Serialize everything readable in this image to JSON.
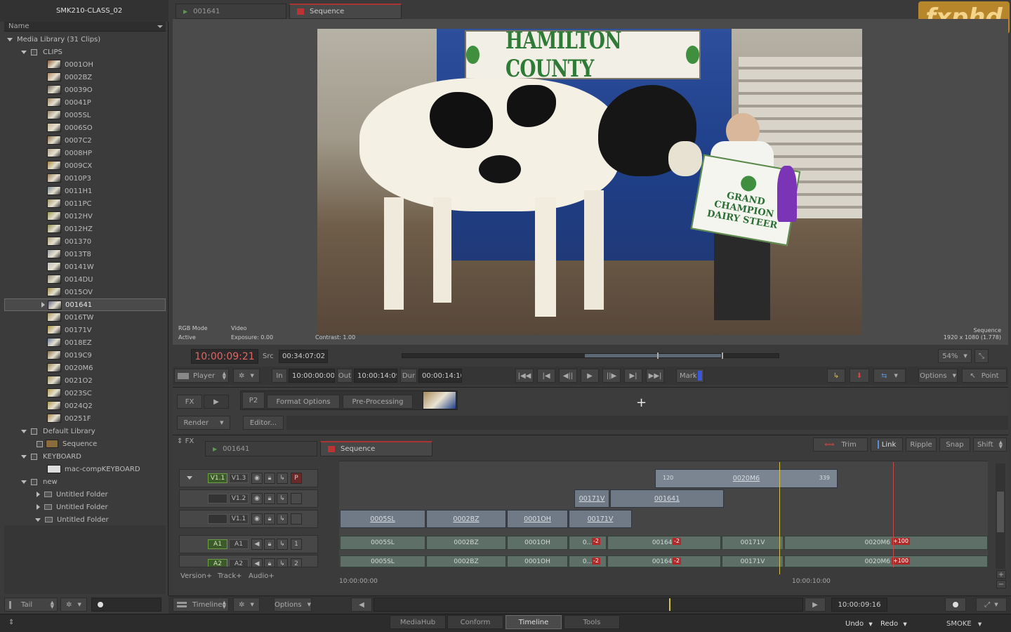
{
  "app": {
    "project_title": "SMK210-CLASS_02",
    "logo": "fxphd",
    "module_name": "SMOKE"
  },
  "library": {
    "column_header": "Name",
    "media_library_label": "Media Library (31 Clips)",
    "clips_folder": "CLIPS",
    "clips": [
      "0001OH",
      "0002BZ",
      "00039O",
      "00041P",
      "0005SL",
      "0006SO",
      "0007C2",
      "0008HP",
      "0009CX",
      "0010P3",
      "0011H1",
      "0011PC",
      "0012HV",
      "0012HZ",
      "001370",
      "0013T8",
      "00141W",
      "0014DU",
      "0015OV",
      "001641",
      "0016TW",
      "00171V",
      "0018EZ",
      "0019C9",
      "0020M6",
      "0021O2",
      "0023SC",
      "0024Q2",
      "00251F"
    ],
    "selected_clip": "001641",
    "default_library": "Default Library",
    "sequence_item": "Sequence",
    "keyboard_folder": "KEYBOARD",
    "keyboard_item": "mac-compKEYBOARD",
    "new_folder": "new",
    "untitled_folders": [
      "Untitled Folder",
      "Untitled Folder",
      "Untitled Folder"
    ],
    "bottom_mode": "Tail"
  },
  "viewer": {
    "tab_source": "001641",
    "tab_sequence": "Sequence",
    "overlay_rgb_mode": "RGB Mode",
    "overlay_active": "Active",
    "overlay_video": "Video",
    "overlay_exposure": "Exposure: 0.00",
    "overlay_contrast": "Contrast: 1.00",
    "overlay_seq_name": "Sequence",
    "overlay_resolution": "1920 x 1080 (1.778)",
    "banner_text": "HAMILTON COUNTY",
    "sign_text": "GRAND CHAMPION DAIRY STEER",
    "zoom": "54%"
  },
  "transport": {
    "timecode": "10:00:09:21",
    "src_label": "Src",
    "src_tc": "00:34:07:02",
    "player_label": "Player",
    "in_label": "In",
    "in_tc": "10:00:00:00",
    "out_label": "Out",
    "out_tc": "10:00:14:09",
    "dur_label": "Dur",
    "dur_tc": "00:00:14:10",
    "mark_label": "Mark",
    "options_label": "Options",
    "point_label": "Point"
  },
  "fx_panel": {
    "fx_label": "FX",
    "p2_label": "P2",
    "format_options": "Format Options",
    "pre_processing": "Pre-Processing",
    "render_label": "Render",
    "editor_label": "Editor..."
  },
  "timeline": {
    "fx_toggle": "FX",
    "tab_source": "001641",
    "tab_sequence": "Sequence",
    "trim_label": "Trim",
    "link_label": "Link",
    "ripple_label": "Ripple",
    "snap_label": "Snap",
    "shift_label": "Shift",
    "tracks": [
      {
        "patch": "V1.1",
        "name": "V1.3"
      },
      {
        "patch": "",
        "name": "V1.2"
      },
      {
        "patch": "",
        "name": "V1.1"
      },
      {
        "patch": "A1",
        "name": "A1",
        "num": "1"
      },
      {
        "patch": "A2",
        "name": "A2",
        "num": "2"
      }
    ],
    "p_badge": "P",
    "v13_clip": "0020M6",
    "v13_in": "120",
    "v13_out": "339",
    "v12_clips": [
      "00171V",
      "001641"
    ],
    "v11_clips": [
      "0005SL",
      "0002BZ",
      "0001OH",
      "00171V"
    ],
    "audio_clips": [
      "0005SL",
      "0002BZ",
      "0001OH",
      "0...",
      "001641",
      "00171V",
      "0020M6"
    ],
    "badge_neg2": "-2",
    "badge_100": "+100",
    "ruler_start": "10:00:00:00",
    "ruler_mark": "10:00:10:00",
    "bottom_buttons": [
      "Version+",
      "Track+",
      "Audio+"
    ]
  },
  "footer": {
    "timeline_label": "Timeline",
    "options_label": "Options",
    "current_tc": "10:00:09:16",
    "tabs": [
      "MediaHub",
      "Conform",
      "Timeline",
      "Tools"
    ],
    "active_tab": "Timeline",
    "undo": "Undo",
    "redo": "Redo"
  },
  "colors": {
    "accent_red": "#b02a2a",
    "playhead": "#d6c24a",
    "timecode_red": "#e05a5a",
    "clip_video": "#6f7a86",
    "clip_audio": "#5d6f66"
  }
}
